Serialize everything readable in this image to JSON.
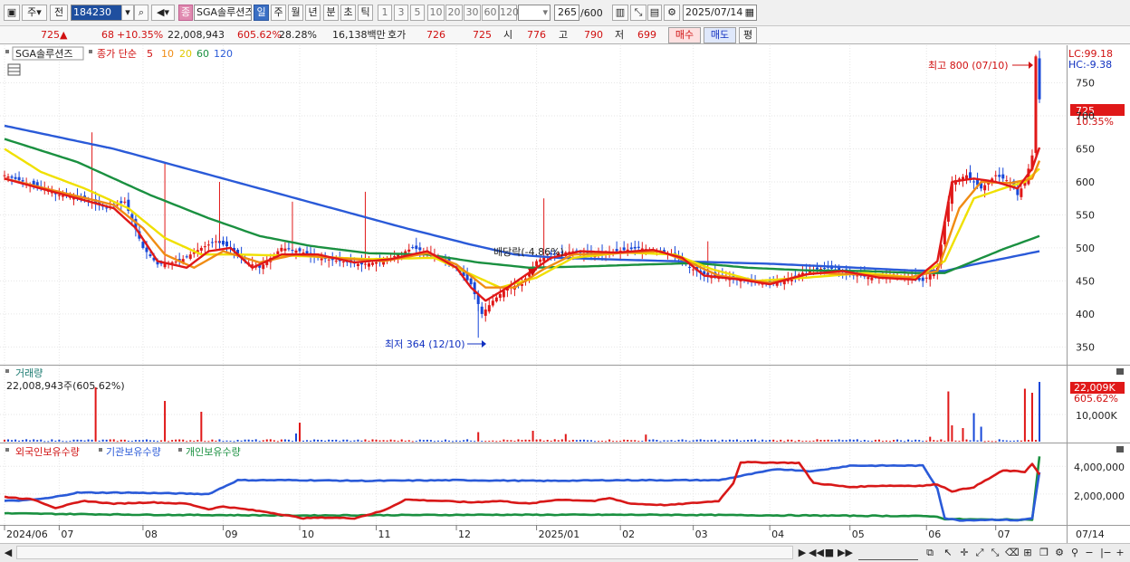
{
  "toolbar": {
    "market_button": "주",
    "prev_button": "전",
    "code_value": "184230",
    "pinned_label": "종",
    "stock_name": "SGA솔루션즈",
    "periods": [
      "일",
      "주",
      "월",
      "년",
      "분",
      "초",
      "틱"
    ],
    "active_period": "일",
    "intervals": [
      "1",
      "3",
      "5",
      "10",
      "20",
      "30",
      "60",
      "120"
    ],
    "count_value": "265",
    "count_max": "/600",
    "date_value": "2025/07/14"
  },
  "infobar": {
    "price": "725",
    "change_arrow": "▲",
    "change": "68",
    "change_pct": "+10.35%",
    "volume": "22,008,943",
    "volume_ratio": "605.62%",
    "turnover": "28.28%",
    "amount": "16,138백만",
    "quote_label": "호가",
    "ask": "726",
    "bid": "725",
    "open_label": "시",
    "open": "776",
    "high_label": "고",
    "high": "790",
    "low_label": "저",
    "low": "699",
    "buy_button": "매수",
    "sell_button": "매도",
    "eval_button": "평"
  },
  "colors": {
    "candle_up": "#e01818",
    "candle_down": "#1848d8",
    "ma5": "#e01818",
    "ma10": "#f08c14",
    "ma20": "#f0e000",
    "ma60": "#1a9040",
    "ma120": "#2a5ad8",
    "foreign": "#d81818",
    "institution": "#2a5ad8",
    "individual": "#1a9040"
  },
  "chart_data": [
    {
      "type": "line",
      "title": "SGA솔루션즈",
      "subtitle": "종가 단순",
      "ma_periods": [
        "5",
        "10",
        "20",
        "60",
        "120"
      ],
      "ylim": [
        330,
        800
      ],
      "yticks": [
        "350",
        "400",
        "450",
        "500",
        "550",
        "600",
        "650",
        "700",
        "750"
      ],
      "x_labels": [
        "2024/06",
        "07",
        "08",
        "09",
        "10",
        "11",
        "12",
        "2025/01",
        "02",
        "03",
        "04",
        "05",
        "06",
        "07",
        "07/14"
      ],
      "x_label_pos": [
        0,
        15,
        38,
        60,
        81,
        102,
        124,
        146,
        169,
        189,
        210,
        232,
        253,
        272,
        294
      ],
      "x_count": 285,
      "close_anchors": [
        [
          0,
          610
        ],
        [
          8,
          595
        ],
        [
          15,
          580
        ],
        [
          22,
          575
        ],
        [
          28,
          560
        ],
        [
          33,
          570
        ],
        [
          38,
          500
        ],
        [
          42,
          475
        ],
        [
          48,
          480
        ],
        [
          54,
          500
        ],
        [
          58,
          510
        ],
        [
          62,
          500
        ],
        [
          66,
          480
        ],
        [
          70,
          470
        ],
        [
          76,
          500
        ],
        [
          81,
          495
        ],
        [
          86,
          485
        ],
        [
          92,
          480
        ],
        [
          98,
          475
        ],
        [
          104,
          480
        ],
        [
          108,
          490
        ],
        [
          112,
          500
        ],
        [
          118,
          490
        ],
        [
          124,
          470
        ],
        [
          128,
          445
        ],
        [
          131,
          400
        ],
        [
          134,
          420
        ],
        [
          138,
          440
        ],
        [
          142,
          445
        ],
        [
          146,
          480
        ],
        [
          150,
          490
        ],
        [
          156,
          495
        ],
        [
          162,
          490
        ],
        [
          168,
          495
        ],
        [
          174,
          500
        ],
        [
          180,
          495
        ],
        [
          184,
          490
        ],
        [
          188,
          470
        ],
        [
          192,
          460
        ],
        [
          198,
          455
        ],
        [
          204,
          450
        ],
        [
          210,
          445
        ],
        [
          214,
          450
        ],
        [
          220,
          465
        ],
        [
          226,
          470
        ],
        [
          232,
          460
        ],
        [
          238,
          455
        ],
        [
          244,
          460
        ],
        [
          248,
          455
        ],
        [
          252,
          450
        ],
        [
          256,
          470
        ],
        [
          258,
          540
        ],
        [
          260,
          600
        ],
        [
          264,
          610
        ],
        [
          268,
          590
        ],
        [
          272,
          610
        ],
        [
          276,
          600
        ],
        [
          278,
          580
        ],
        [
          280,
          600
        ],
        [
          282,
          640
        ],
        [
          283,
          790
        ],
        [
          284,
          725
        ]
      ],
      "ma5_anchors": [
        [
          0,
          605
        ],
        [
          10,
          590
        ],
        [
          20,
          575
        ],
        [
          30,
          560
        ],
        [
          36,
          530
        ],
        [
          42,
          480
        ],
        [
          50,
          470
        ],
        [
          56,
          495
        ],
        [
          62,
          500
        ],
        [
          68,
          470
        ],
        [
          76,
          490
        ],
        [
          86,
          490
        ],
        [
          96,
          478
        ],
        [
          106,
          483
        ],
        [
          116,
          495
        ],
        [
          124,
          470
        ],
        [
          128,
          440
        ],
        [
          132,
          420
        ],
        [
          138,
          440
        ],
        [
          146,
          470
        ],
        [
          150,
          485
        ],
        [
          158,
          495
        ],
        [
          168,
          493
        ],
        [
          178,
          497
        ],
        [
          186,
          485
        ],
        [
          192,
          458
        ],
        [
          202,
          452
        ],
        [
          210,
          445
        ],
        [
          220,
          460
        ],
        [
          230,
          465
        ],
        [
          240,
          455
        ],
        [
          250,
          452
        ],
        [
          256,
          480
        ],
        [
          260,
          600
        ],
        [
          266,
          605
        ],
        [
          272,
          600
        ],
        [
          278,
          590
        ],
        [
          282,
          620
        ],
        [
          284,
          652
        ]
      ],
      "ma10_anchors": [
        [
          0,
          605
        ],
        [
          15,
          585
        ],
        [
          30,
          565
        ],
        [
          38,
          530
        ],
        [
          44,
          490
        ],
        [
          52,
          470
        ],
        [
          60,
          495
        ],
        [
          70,
          478
        ],
        [
          80,
          490
        ],
        [
          90,
          485
        ],
        [
          104,
          480
        ],
        [
          116,
          492
        ],
        [
          124,
          475
        ],
        [
          132,
          440
        ],
        [
          140,
          440
        ],
        [
          148,
          468
        ],
        [
          156,
          490
        ],
        [
          168,
          492
        ],
        [
          180,
          495
        ],
        [
          188,
          478
        ],
        [
          196,
          458
        ],
        [
          210,
          447
        ],
        [
          222,
          462
        ],
        [
          234,
          460
        ],
        [
          248,
          455
        ],
        [
          256,
          465
        ],
        [
          262,
          560
        ],
        [
          268,
          600
        ],
        [
          276,
          598
        ],
        [
          282,
          605
        ],
        [
          284,
          632
        ]
      ],
      "ma20_anchors": [
        [
          0,
          650
        ],
        [
          10,
          615
        ],
        [
          22,
          590
        ],
        [
          34,
          560
        ],
        [
          44,
          515
        ],
        [
          54,
          490
        ],
        [
          64,
          490
        ],
        [
          80,
          488
        ],
        [
          100,
          483
        ],
        [
          118,
          485
        ],
        [
          128,
          460
        ],
        [
          136,
          440
        ],
        [
          146,
          455
        ],
        [
          156,
          485
        ],
        [
          170,
          493
        ],
        [
          184,
          490
        ],
        [
          194,
          468
        ],
        [
          206,
          450
        ],
        [
          220,
          455
        ],
        [
          236,
          462
        ],
        [
          250,
          455
        ],
        [
          258,
          480
        ],
        [
          266,
          575
        ],
        [
          274,
          590
        ],
        [
          280,
          600
        ],
        [
          284,
          620
        ]
      ],
      "ma60_anchors": [
        [
          0,
          665
        ],
        [
          20,
          630
        ],
        [
          40,
          580
        ],
        [
          56,
          545
        ],
        [
          70,
          518
        ],
        [
          84,
          503
        ],
        [
          100,
          492
        ],
        [
          116,
          490
        ],
        [
          130,
          478
        ],
        [
          144,
          470
        ],
        [
          160,
          472
        ],
        [
          176,
          475
        ],
        [
          190,
          477
        ],
        [
          204,
          470
        ],
        [
          220,
          466
        ],
        [
          236,
          465
        ],
        [
          250,
          462
        ],
        [
          258,
          462
        ],
        [
          266,
          480
        ],
        [
          274,
          498
        ],
        [
          284,
          518
        ]
      ],
      "ma120_anchors": [
        [
          0,
          685
        ],
        [
          30,
          650
        ],
        [
          50,
          620
        ],
        [
          70,
          590
        ],
        [
          90,
          560
        ],
        [
          110,
          530
        ],
        [
          128,
          505
        ],
        [
          140,
          490
        ],
        [
          152,
          485
        ],
        [
          170,
          482
        ],
        [
          190,
          479
        ],
        [
          210,
          476
        ],
        [
          230,
          471
        ],
        [
          248,
          466
        ],
        [
          258,
          465
        ],
        [
          266,
          475
        ],
        [
          276,
          486
        ],
        [
          284,
          495
        ]
      ],
      "annotations": {
        "high": "최고 800 (07/10)",
        "low": "최저 364 (12/10)",
        "dividend": "배당락(-4.86%)",
        "lc": "LC:99.18",
        "hc": "HC:-9.38",
        "last_price": "725",
        "last_pct": "10.35%"
      }
    },
    {
      "type": "bar",
      "title": "거래량",
      "value_label": "22,008,943주(605.62%)",
      "ylim": [
        0,
        22009
      ],
      "yticks": [
        "10,000K"
      ],
      "last_value": "22,009K",
      "last_pct": "605.62%",
      "spikes": [
        [
          25,
          20000,
          "up"
        ],
        [
          44,
          15000,
          "up"
        ],
        [
          54,
          11000,
          "up"
        ],
        [
          80,
          3000,
          "down"
        ],
        [
          81,
          7000,
          "up"
        ],
        [
          130,
          3500,
          "up"
        ],
        [
          145,
          4000,
          "up"
        ],
        [
          154,
          2800,
          "up"
        ],
        [
          176,
          2600,
          "up"
        ],
        [
          254,
          1800,
          "up"
        ],
        [
          259,
          18500,
          "up"
        ],
        [
          260,
          6000,
          "up"
        ],
        [
          263,
          5000,
          "up"
        ],
        [
          266,
          10500,
          "down"
        ],
        [
          268,
          5500,
          "down"
        ],
        [
          280,
          19500,
          "up"
        ],
        [
          282,
          18000,
          "up"
        ],
        [
          284,
          22009,
          "down"
        ]
      ]
    },
    {
      "type": "line",
      "series": [
        {
          "name": "외국인보유수량",
          "anchors": [
            [
              0,
              1800000
            ],
            [
              8,
              1600000
            ],
            [
              14,
              1000000
            ],
            [
              22,
              1500000
            ],
            [
              30,
              1300000
            ],
            [
              40,
              1400000
            ],
            [
              50,
              1300000
            ],
            [
              56,
              900000
            ],
            [
              60,
              1100000
            ],
            [
              72,
              700000
            ],
            [
              82,
              250000
            ],
            [
              88,
              300000
            ],
            [
              96,
              250000
            ],
            [
              104,
              800000
            ],
            [
              110,
              1600000
            ],
            [
              120,
              1500000
            ],
            [
              128,
              1400000
            ],
            [
              136,
              1500000
            ],
            [
              144,
              1300000
            ],
            [
              152,
              1600000
            ],
            [
              162,
              1500000
            ],
            [
              166,
              1700000
            ],
            [
              172,
              1300000
            ],
            [
              182,
              1200000
            ],
            [
              196,
              1500000
            ],
            [
              200,
              2800000
            ],
            [
              202,
              4300000
            ],
            [
              218,
              4250000
            ],
            [
              222,
              2800000
            ],
            [
              232,
              2500000
            ],
            [
              240,
              2600000
            ],
            [
              252,
              2600000
            ],
            [
              256,
              2700000
            ],
            [
              260,
              2200000
            ],
            [
              266,
              2500000
            ],
            [
              274,
              3700000
            ],
            [
              280,
              3600000
            ],
            [
              282,
              4200000
            ],
            [
              284,
              3400000
            ]
          ]
        },
        {
          "name": "기관보유수량",
          "anchors": [
            [
              0,
              1500000
            ],
            [
              6,
              1550000
            ],
            [
              12,
              1700000
            ],
            [
              20,
              2100000
            ],
            [
              34,
              2100000
            ],
            [
              56,
              2000000
            ],
            [
              64,
              3000000
            ],
            [
              80,
              3000000
            ],
            [
              100,
              2950000
            ],
            [
              124,
              3000000
            ],
            [
              148,
              2950000
            ],
            [
              168,
              3000000
            ],
            [
              196,
              3000000
            ],
            [
              204,
              3400000
            ],
            [
              212,
              3800000
            ],
            [
              222,
              3650000
            ],
            [
              232,
              4050000
            ],
            [
              252,
              4050000
            ],
            [
              256,
              2400000
            ],
            [
              258,
              250000
            ],
            [
              262,
              100000
            ],
            [
              272,
              150000
            ],
            [
              278,
              100000
            ],
            [
              282,
              250000
            ],
            [
              284,
              3600000
            ]
          ]
        },
        {
          "name": "개인보유수량",
          "anchors": [
            [
              0,
              600000
            ],
            [
              40,
              500000
            ],
            [
              80,
              450000
            ],
            [
              130,
              500000
            ],
            [
              180,
              500000
            ],
            [
              220,
              450000
            ],
            [
              255,
              400000
            ],
            [
              258,
              200000
            ],
            [
              270,
              150000
            ],
            [
              282,
              150000
            ],
            [
              284,
              4700000
            ]
          ]
        }
      ],
      "ylim": [
        -100000,
        5000000
      ],
      "yticks": [
        "2,000,000",
        "4,000,000"
      ]
    }
  ]
}
